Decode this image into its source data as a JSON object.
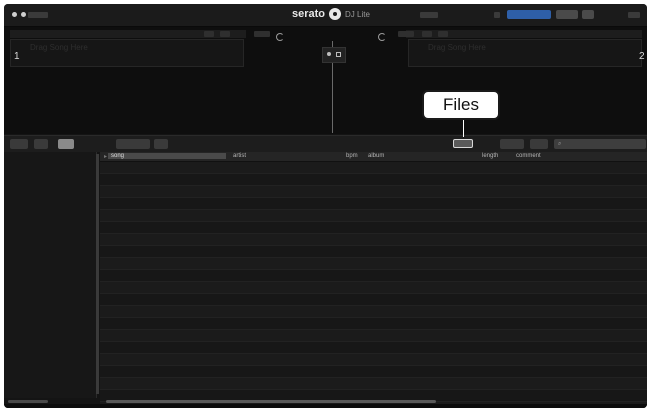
{
  "app": {
    "brand_name": "serato",
    "brand_sub": "DJ Lite"
  },
  "decks": {
    "left_number": "1",
    "right_number": "2",
    "left_hint": "Drag Song Here",
    "right_hint": "Drag Song Here"
  },
  "callout": {
    "label": "Files"
  },
  "library": {
    "columns": [
      "song",
      "artist",
      "bpm",
      "album",
      "length",
      "comment"
    ],
    "row_count": 21
  },
  "colors": {
    "background": "#141414",
    "accent": "#2e5fa8"
  }
}
